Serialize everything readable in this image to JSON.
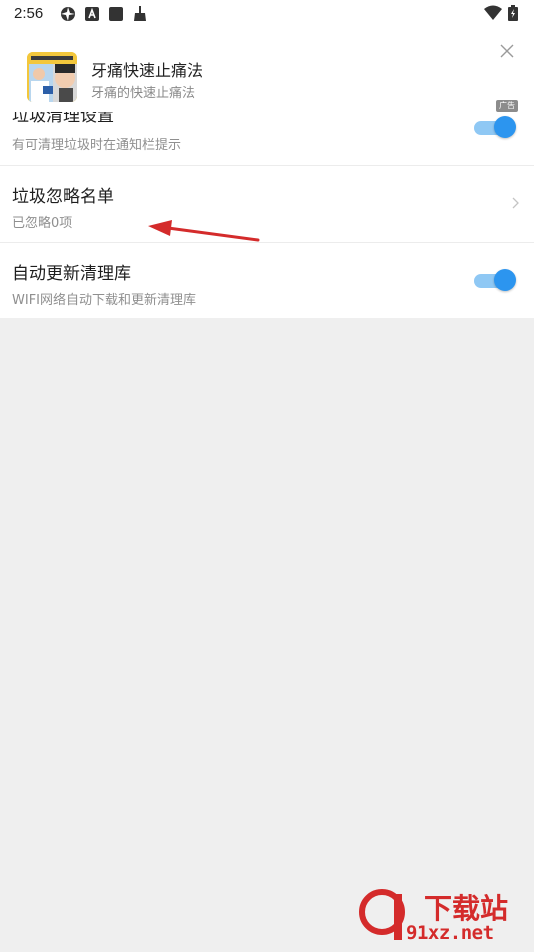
{
  "status_bar": {
    "time": "2:56",
    "icons": [
      "aperture-icon",
      "a-icon",
      "square-icon",
      "broom-icon",
      "wifi-icon",
      "battery-icon"
    ]
  },
  "ad": {
    "title": "牙痛快速止痛法",
    "subtitle": "牙痛的快速止痛法",
    "badge": "广告"
  },
  "settings": {
    "cleanup_notify": {
      "title": "垃圾清理设置",
      "subtitle": "有可清理垃圾时在通知栏提示",
      "enabled": true
    },
    "ignore_list": {
      "title": "垃圾忽略名单",
      "subtitle": "已忽略0项"
    },
    "auto_update": {
      "title": "自动更新清理库",
      "subtitle": "WIFI网络自动下载和更新清理库",
      "enabled": true
    }
  },
  "watermark": {
    "brand": "下载站",
    "url": "91xz.net"
  },
  "colors": {
    "accent": "#2c95ef",
    "track": "#8fc8f4",
    "annotation": "#d42b2b"
  }
}
